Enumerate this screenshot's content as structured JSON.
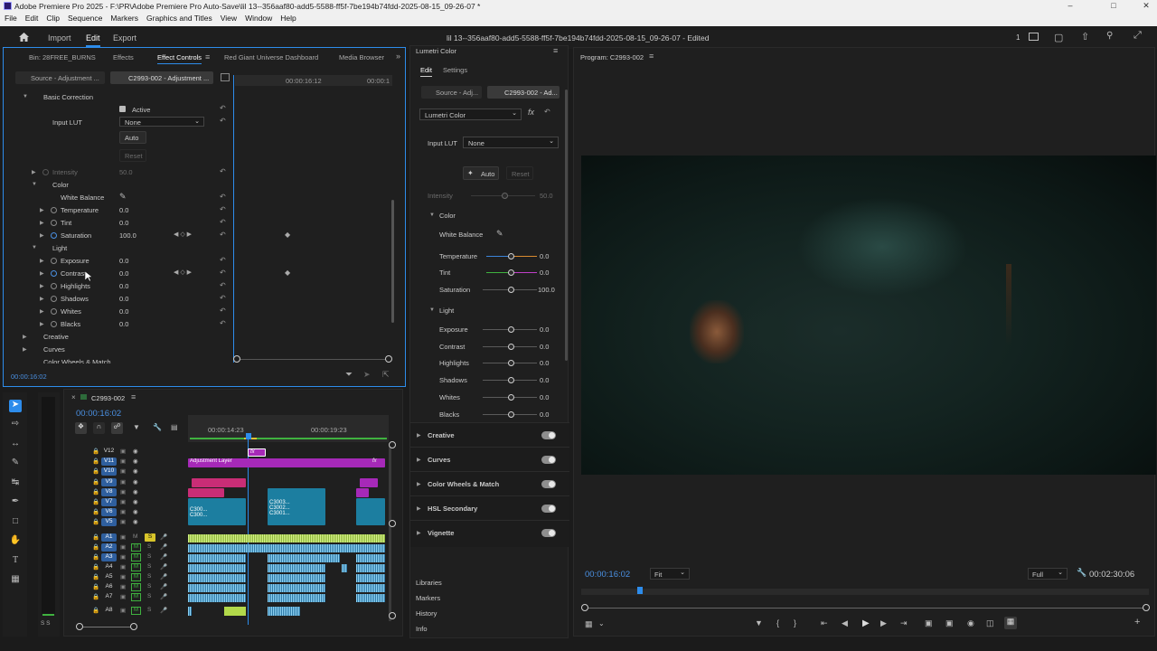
{
  "app": {
    "window_title": "Adobe Premiere Pro 2025 - F:\\PR\\Adobe Premiere Pro Auto-Save\\lil 13--356aaf80-add5-5588-ff5f-7be194b74fdd-2025-08-15_09-26-07 *",
    "menus": [
      "File",
      "Edit",
      "Clip",
      "Sequence",
      "Markers",
      "Graphics and Titles",
      "View",
      "Window",
      "Help"
    ]
  },
  "workspace": {
    "home": "home-icon",
    "tabs": [
      "Import",
      "Edit",
      "Export"
    ],
    "active_tab": "Edit",
    "doc_title": "lil 13--356aaf80-add5-5588-ff5f-7be194b74fdd-2025-08-15_09-26-07 - Edited",
    "right_count": "1"
  },
  "effect_controls": {
    "tabs": [
      "Bin: 28FREE_BURNS",
      "Effects",
      "Effect Controls",
      "Red Giant Universe Dashboard",
      "Media Browser"
    ],
    "source_tab": "Source - Adjustment ...",
    "clip_tab": "C2993-002 - Adjustment ...",
    "timecodes": [
      "00:00:16:12",
      "00:00:1"
    ],
    "basic_correction": "Basic Correction",
    "active_label": "Active",
    "input_lut_label": "Input LUT",
    "input_lut_value": "None",
    "auto_btn": "Auto",
    "reset_btn": "Reset",
    "intensity_label": "Intensity",
    "intensity_value": "50.0",
    "color_group": "Color",
    "white_balance": "White Balance",
    "color_rows": [
      {
        "label": "Temperature",
        "value": "0.0"
      },
      {
        "label": "Tint",
        "value": "0.0"
      },
      {
        "label": "Saturation",
        "value": "100.0"
      }
    ],
    "light_group": "Light",
    "light_rows": [
      {
        "label": "Exposure",
        "value": "0.0"
      },
      {
        "label": "Contrast",
        "value": "0.0"
      },
      {
        "label": "Highlights",
        "value": "0.0"
      },
      {
        "label": "Shadows",
        "value": "0.0"
      },
      {
        "label": "Whites",
        "value": "0.0"
      },
      {
        "label": "Blacks",
        "value": "0.0"
      }
    ],
    "sections": [
      "Creative",
      "Curves",
      "Color Wheels & Match"
    ],
    "current_time": "00:00:16:02"
  },
  "lumetri": {
    "panel_title": "Lumetri Color",
    "tabs": [
      "Edit",
      "Settings"
    ],
    "source_tab": "Source - Adj...",
    "clip_tab": "C2993-002 - Ad...",
    "effect_select": "Lumetri Color",
    "input_lut_label": "Input LUT",
    "input_lut_value": "None",
    "auto_btn": "Auto",
    "reset_btn": "Reset",
    "intensity_label": "Intensity",
    "intensity_value": "50.0",
    "color_group": "Color",
    "white_balance": "White Balance",
    "color_rows": [
      {
        "label": "Temperature",
        "value": "0.0"
      },
      {
        "label": "Tint",
        "value": "0.0"
      },
      {
        "label": "Saturation",
        "value": "100.0"
      }
    ],
    "light_group": "Light",
    "light_rows": [
      {
        "label": "Exposure",
        "value": "0.0"
      },
      {
        "label": "Contrast",
        "value": "0.0"
      },
      {
        "label": "Highlights",
        "value": "0.0"
      },
      {
        "label": "Shadows",
        "value": "0.0"
      },
      {
        "label": "Whites",
        "value": "0.0"
      },
      {
        "label": "Blacks",
        "value": "0.0"
      }
    ],
    "sections": [
      "Creative",
      "Curves",
      "Color Wheels & Match",
      "HSL Secondary",
      "Vignette"
    ],
    "bottom_panels": [
      "Libraries",
      "Markers",
      "History",
      "Info"
    ]
  },
  "timeline": {
    "sequence_name": "C2993-002",
    "timecode": "00:00:16:02",
    "ruler_labels": [
      "00:00:14:23",
      "00:00:19:23"
    ],
    "video_tracks": [
      "V12",
      "V11",
      "V10",
      "V9",
      "V8",
      "V7",
      "V6",
      "V5"
    ],
    "audio_tracks": [
      "A1",
      "A2",
      "A3",
      "A4",
      "A5",
      "A6",
      "A7",
      "A8"
    ],
    "adjustment_layer": "Adjustment Layer",
    "fx": "fx",
    "clip_names": [
      "C300...",
      "C300...",
      "C3003...",
      "C3002...",
      "C3001..."
    ],
    "audio_solo": "S",
    "audio_mute": "M"
  },
  "program": {
    "title": "Program: C2993-002",
    "timecode": "00:00:16:02",
    "fit": "Fit",
    "quality": "Full",
    "duration": "00:02:30:06"
  },
  "meters": {
    "labels": [
      "S",
      "S"
    ]
  },
  "tools": [
    "selection-tool",
    "track-select-tool",
    "ripple-edit-tool",
    "razor-tool",
    "slip-tool",
    "pen-tool",
    "rectangle-tool",
    "hand-tool",
    "type-tool",
    "caption-tool"
  ],
  "colors": {
    "accent": "#2d8ceb",
    "timecode_blue": "#4a90e2",
    "adjustment_purple": "#a629b8",
    "video_teal": "#1c7ea0",
    "video_pink": "#c92d76",
    "audio_blue": "#2f7aa8",
    "audio_green": "#b2d94a"
  }
}
